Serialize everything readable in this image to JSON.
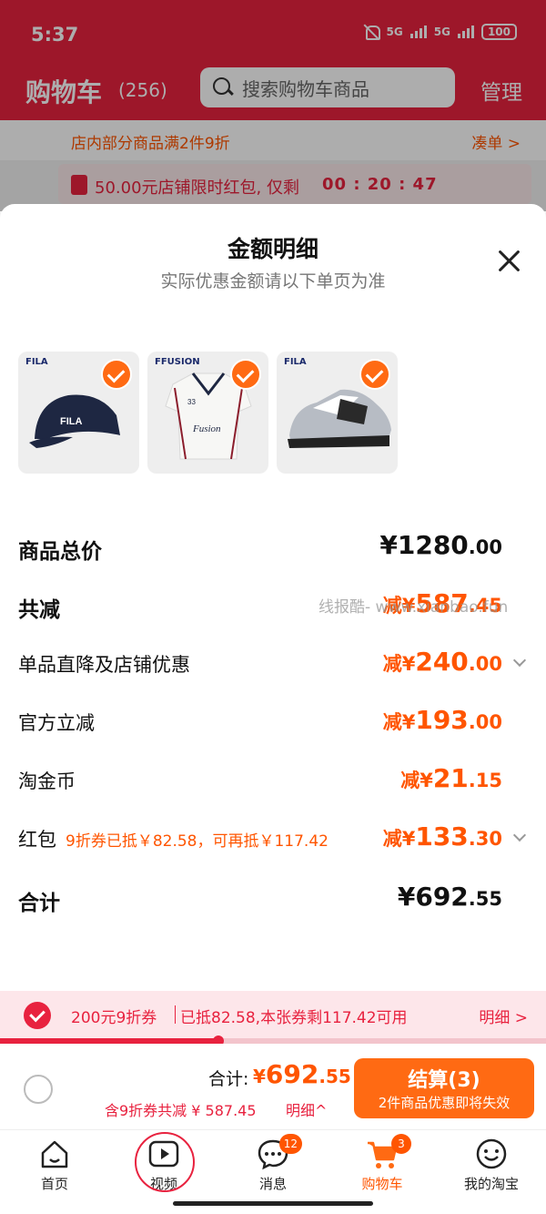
{
  "status": {
    "time": "5:37",
    "net1": "5G",
    "net2": "5G",
    "battery": "100"
  },
  "header": {
    "title": "购物车",
    "count": "(256)",
    "search_placeholder": "搜索购物车商品",
    "manage": "管理"
  },
  "promo": {
    "text": "店内部分商品满2件9折",
    "action": "凑单 >"
  },
  "redpack": {
    "text": "50.00元店铺限时红包, 仅剩",
    "timer": "00 : 20 : 47"
  },
  "sheet": {
    "title": "金额明细",
    "subtitle": "实际优惠金额请以下单页为准",
    "products": [
      {
        "brand": "FILA",
        "icon": "cap"
      },
      {
        "brand": "FFUSION",
        "icon": "jersey"
      },
      {
        "brand": "FILA",
        "icon": "sneaker"
      }
    ],
    "rows": {
      "total_price": {
        "label": "商品总价",
        "int": "¥1280",
        "dec": ".00"
      },
      "total_discount": {
        "label": "共减",
        "cur": "减¥",
        "int": "587",
        "dec": ".45"
      },
      "shop_discount": {
        "label": "单品直降及店铺优惠",
        "cur": "减¥",
        "int": "240",
        "dec": ".00"
      },
      "official": {
        "label": "官方立减",
        "cur": "减¥",
        "int": "193",
        "dec": ".00"
      },
      "coins": {
        "label": "淘金币",
        "cur": "减¥",
        "int": "21",
        "dec": ".15"
      },
      "redpack": {
        "label": "红包",
        "note": "9折券已抵￥82.58，可再抵￥117.42",
        "cur": "减¥",
        "int": "133",
        "dec": ".30"
      },
      "sum": {
        "label": "合计",
        "int": "¥692",
        "dec": ".55"
      }
    },
    "watermark": "线报酷- www.xianbao.fun"
  },
  "coupon": {
    "title": "200元9折券",
    "info": "已抵82.58,本张券剩117.42可用",
    "more": "明细 >",
    "progress": 0.4
  },
  "checkout": {
    "total_label": "合计:",
    "total_cur": "¥",
    "total_int": "692",
    "total_dec": ".55",
    "sub": "含9折券共减 ¥ 587.45",
    "detail": "明细^",
    "button": "结算(3)",
    "button_sub": "2件商品优惠即将失效"
  },
  "tabs": [
    {
      "label": "首页",
      "icon": "home-icon"
    },
    {
      "label": "视频",
      "icon": "video-icon"
    },
    {
      "label": "消息",
      "icon": "message-icon",
      "badge": "12"
    },
    {
      "label": "购物车",
      "icon": "cart-icon",
      "badge": "3",
      "active": true
    },
    {
      "label": "我的淘宝",
      "icon": "profile-icon"
    }
  ],
  "colors": {
    "brand_red": "#e8223f",
    "accent_orange": "#ff5500",
    "button_orange": "#ff6a13"
  }
}
